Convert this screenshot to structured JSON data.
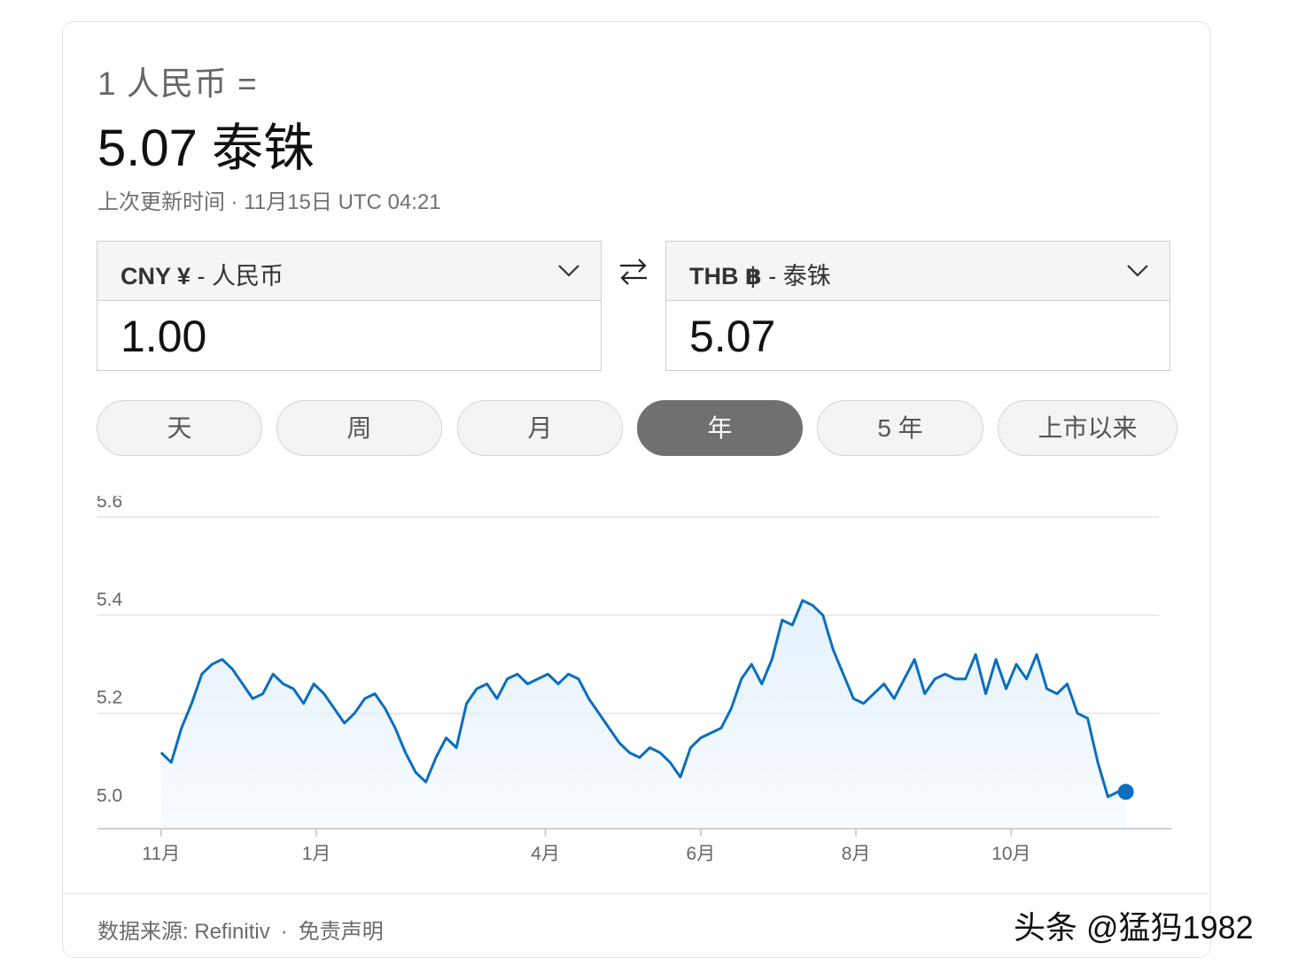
{
  "summary": {
    "from_line": "1 人民币 =",
    "to_line": "5.07 泰铢",
    "updated": "上次更新时间 · 11月15日 UTC 04:21"
  },
  "converter": {
    "from": {
      "code": "CNY ¥",
      "name": " - 人民币",
      "value": "1.00"
    },
    "to": {
      "code": "THB ฿",
      "name": " - 泰铢",
      "value": "5.07"
    },
    "icons": {
      "dropdown": "chevron-down-icon",
      "swap": "swap-arrows-icon"
    }
  },
  "ranges": [
    {
      "label": "天",
      "active": false
    },
    {
      "label": "周",
      "active": false
    },
    {
      "label": "月",
      "active": false
    },
    {
      "label": "年",
      "active": true
    },
    {
      "label": "5 年",
      "active": false
    },
    {
      "label": "上市以来",
      "active": false
    }
  ],
  "footer": {
    "source_prefix": "数据来源: ",
    "source": "Refinitiv",
    "separator": "·",
    "disclaimer": "免责声明"
  },
  "watermark": "头条 @猛犸1982",
  "chart_data": {
    "type": "area",
    "x": [
      "2022-11-01",
      "2022-11-05",
      "2022-11-09",
      "2022-11-13",
      "2022-11-17",
      "2022-11-21",
      "2022-11-25",
      "2022-11-29",
      "2022-12-03",
      "2022-12-07",
      "2022-12-11",
      "2022-12-15",
      "2022-12-19",
      "2022-12-23",
      "2022-12-27",
      "2022-12-31",
      "2023-01-04",
      "2023-01-08",
      "2023-01-12",
      "2023-01-16",
      "2023-01-20",
      "2023-01-24",
      "2023-01-28",
      "2023-02-01",
      "2023-02-05",
      "2023-02-09",
      "2023-02-13",
      "2023-02-17",
      "2023-02-21",
      "2023-02-25",
      "2023-03-01",
      "2023-03-05",
      "2023-03-09",
      "2023-03-13",
      "2023-03-17",
      "2023-03-21",
      "2023-03-25",
      "2023-03-29",
      "2023-04-02",
      "2023-04-06",
      "2023-04-10",
      "2023-04-14",
      "2023-04-18",
      "2023-04-22",
      "2023-04-26",
      "2023-04-30",
      "2023-05-04",
      "2023-05-08",
      "2023-05-12",
      "2023-05-16",
      "2023-05-20",
      "2023-05-24",
      "2023-05-28",
      "2023-06-01",
      "2023-06-05",
      "2023-06-09",
      "2023-06-13",
      "2023-06-17",
      "2023-06-21",
      "2023-06-25",
      "2023-06-29",
      "2023-07-03",
      "2023-07-07",
      "2023-07-11",
      "2023-07-15",
      "2023-07-19",
      "2023-07-23",
      "2023-07-27",
      "2023-07-31",
      "2023-08-04",
      "2023-08-08",
      "2023-08-12",
      "2023-08-16",
      "2023-08-20",
      "2023-08-24",
      "2023-08-28",
      "2023-09-01",
      "2023-09-05",
      "2023-09-09",
      "2023-09-13",
      "2023-09-17",
      "2023-09-21",
      "2023-09-25",
      "2023-09-29",
      "2023-10-03",
      "2023-10-07",
      "2023-10-11",
      "2023-10-15",
      "2023-10-19",
      "2023-10-23",
      "2023-10-27",
      "2023-10-31",
      "2023-11-04",
      "2023-11-08",
      "2023-11-12",
      "2023-11-15"
    ],
    "series": [
      {
        "values": [
          5.12,
          5.1,
          5.17,
          5.22,
          5.28,
          5.3,
          5.31,
          5.29,
          5.26,
          5.23,
          5.24,
          5.28,
          5.26,
          5.25,
          5.22,
          5.26,
          5.24,
          5.21,
          5.18,
          5.2,
          5.23,
          5.24,
          5.21,
          5.17,
          5.12,
          5.08,
          5.06,
          5.11,
          5.15,
          5.13,
          5.22,
          5.25,
          5.26,
          5.23,
          5.27,
          5.28,
          5.26,
          5.27,
          5.28,
          5.26,
          5.28,
          5.27,
          5.23,
          5.2,
          5.17,
          5.14,
          5.12,
          5.11,
          5.13,
          5.12,
          5.1,
          5.07,
          5.13,
          5.15,
          5.16,
          5.17,
          5.21,
          5.27,
          5.3,
          5.26,
          5.31,
          5.39,
          5.38,
          5.43,
          5.42,
          5.4,
          5.33,
          5.28,
          5.23,
          5.22,
          5.24,
          5.26,
          5.23,
          5.27,
          5.31,
          5.24,
          5.27,
          5.28,
          5.27,
          5.27,
          5.32,
          5.24,
          5.31,
          5.25,
          5.3,
          5.27,
          5.32,
          5.25,
          5.24,
          5.26,
          5.2,
          5.19,
          5.1,
          5.03,
          5.04,
          5.04
        ]
      }
    ],
    "y_ticks": [
      "5.0",
      "5.2",
      "5.4",
      "5.6"
    ],
    "x_ticks": [
      {
        "label": "11月",
        "date": "2022-11-01"
      },
      {
        "label": "1月",
        "date": "2023-01-01"
      },
      {
        "label": "4月",
        "date": "2023-04-01"
      },
      {
        "label": "6月",
        "date": "2023-06-01"
      },
      {
        "label": "8月",
        "date": "2023-08-01"
      },
      {
        "label": "10月",
        "date": "2023-10-01"
      }
    ],
    "ylim": [
      4.965,
      5.6
    ],
    "xlim": [
      "2022-10-07",
      "2023-11-28"
    ],
    "grid": true,
    "colors": {
      "line": "#0a6ebd",
      "area": "#e3f0fb",
      "grid": "#e4e4e4",
      "axis": "#cfcfcf"
    }
  }
}
